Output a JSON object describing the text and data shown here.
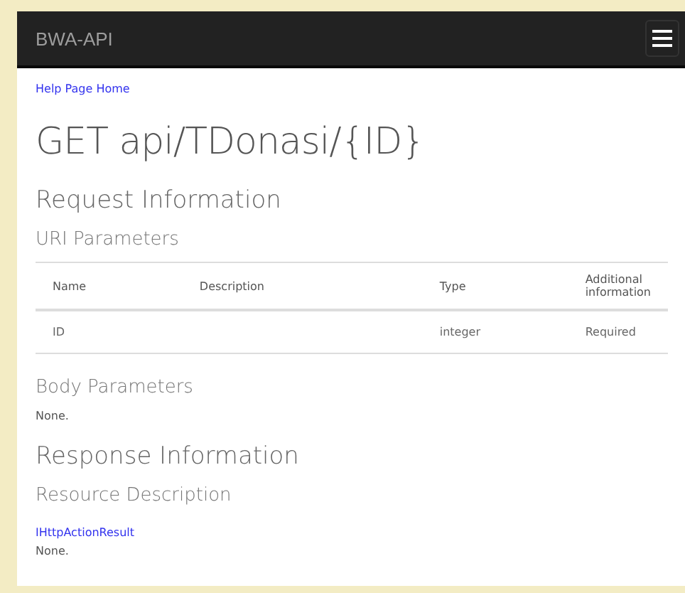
{
  "navbar": {
    "brand": "BWA-API",
    "menu_button": true
  },
  "breadcrumb_link": "Help Page Home",
  "title": "GET api/TDonasi/{ID}",
  "request": {
    "heading": "Request Information",
    "uri_heading": "URI Parameters",
    "table": {
      "columns": [
        "Name",
        "Description",
        "Type",
        "Additional information"
      ],
      "rows": [
        [
          "ID",
          "",
          "integer",
          "Required"
        ]
      ]
    },
    "body_heading": "Body Parameters",
    "body_text": "None."
  },
  "response": {
    "heading": "Response Information",
    "resource_heading": "Resource Description",
    "resource_link": "IHttpActionResult",
    "resource_text": "None."
  }
}
